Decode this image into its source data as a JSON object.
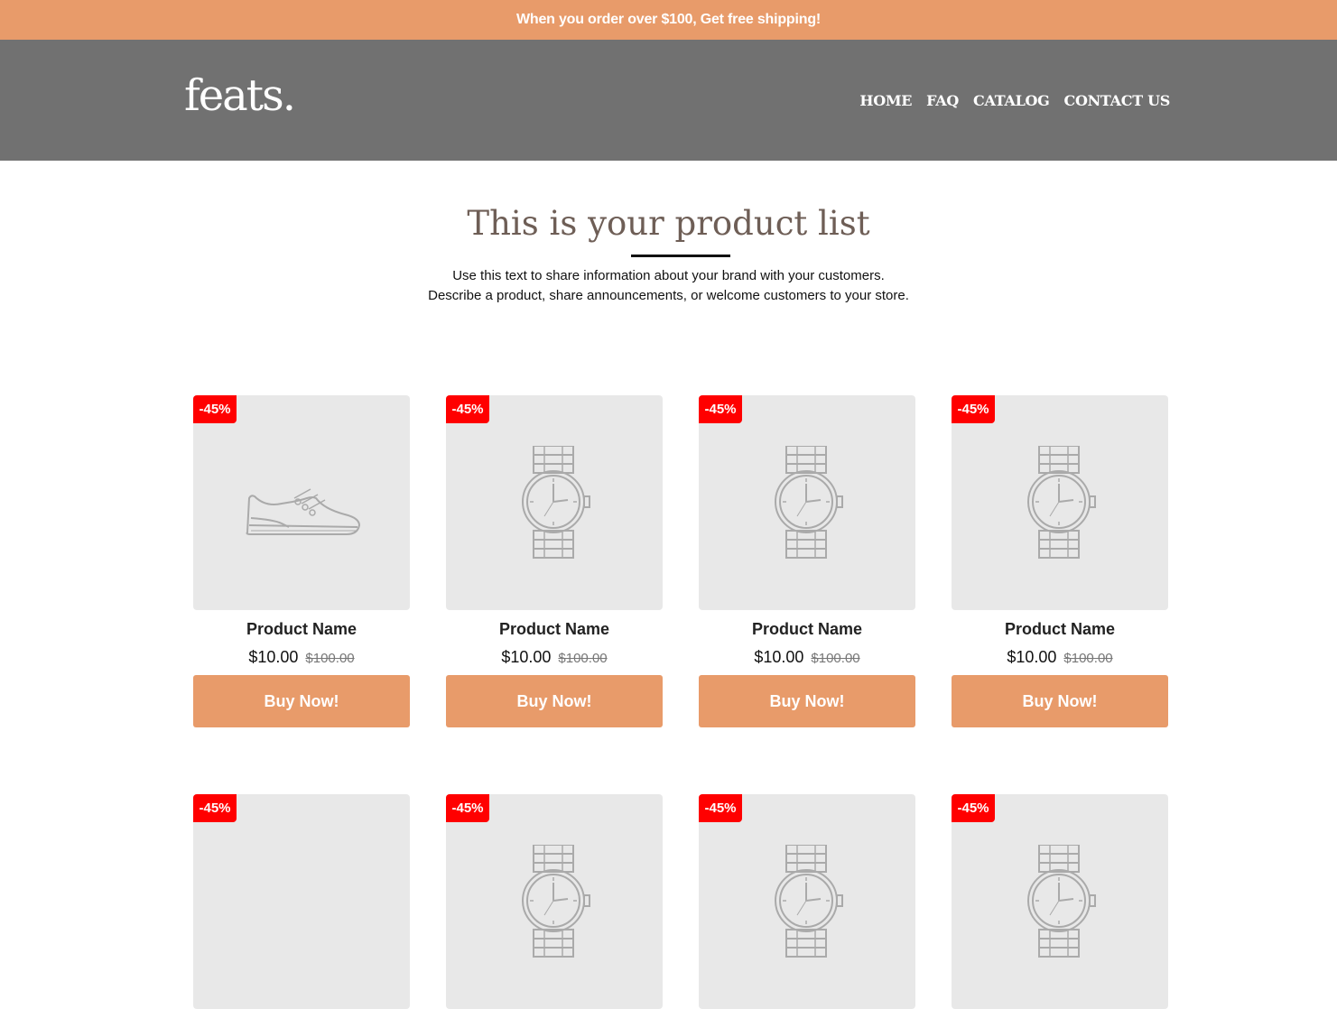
{
  "promo": {
    "text": "When you order over $100, Get free shipping!"
  },
  "header": {
    "logo": "feats.",
    "nav": [
      "HOME",
      "FAQ",
      "CATALOG",
      "CONTACT US"
    ]
  },
  "hero": {
    "title": "This is your product list",
    "line1": "Use this text to share information about your brand with your customers.",
    "line2": "Describe a product, share announcements, or welcome customers to your store."
  },
  "products": [
    {
      "badge": "-45%",
      "icon": "shoe-icon",
      "name": "Product Name",
      "price": "$10.00",
      "old_price": "$100.00",
      "button": "Buy Now!"
    },
    {
      "badge": "-45%",
      "icon": "watch-icon",
      "name": "Product Name",
      "price": "$10.00",
      "old_price": "$100.00",
      "button": "Buy Now!"
    },
    {
      "badge": "-45%",
      "icon": "watch-icon",
      "name": "Product Name",
      "price": "$10.00",
      "old_price": "$100.00",
      "button": "Buy Now!"
    },
    {
      "badge": "-45%",
      "icon": "watch-icon",
      "name": "Product Name",
      "price": "$10.00",
      "old_price": "$100.00",
      "button": "Buy Now!"
    },
    {
      "badge": "-45%",
      "icon": "shoe-icon",
      "name": "",
      "price": "",
      "old_price": "",
      "button": ""
    },
    {
      "badge": "-45%",
      "icon": "watch-icon",
      "name": "",
      "price": "",
      "old_price": "",
      "button": ""
    },
    {
      "badge": "-45%",
      "icon": "watch-icon",
      "name": "",
      "price": "",
      "old_price": "",
      "button": ""
    },
    {
      "badge": "-45%",
      "icon": "watch-icon",
      "name": "",
      "price": "",
      "old_price": "",
      "button": ""
    }
  ],
  "colors": {
    "accent": "#E89B6A",
    "header_bg": "#717171",
    "badge": "#FF0000",
    "card_bg": "#E8E8E8",
    "title": "#6E5E56"
  }
}
